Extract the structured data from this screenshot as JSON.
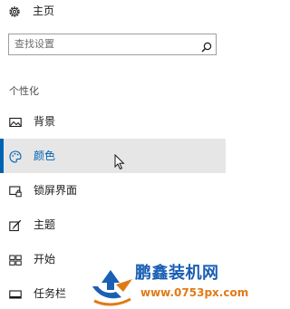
{
  "home": {
    "label": "主页",
    "icon": "gear-icon"
  },
  "search": {
    "placeholder": "查找设置",
    "icon": "search-icon"
  },
  "section_title": "个性化",
  "nav": [
    {
      "label": "背景",
      "icon": "image-icon",
      "selected": false
    },
    {
      "label": "颜色",
      "icon": "palette-icon",
      "selected": true
    },
    {
      "label": "锁屏界面",
      "icon": "lock-screen-icon",
      "selected": false
    },
    {
      "label": "主题",
      "icon": "theme-brush-icon",
      "selected": false
    },
    {
      "label": "开始",
      "icon": "start-grid-icon",
      "selected": false
    },
    {
      "label": "任务栏",
      "icon": "taskbar-icon",
      "selected": false
    }
  ],
  "colors": {
    "accent": "#0063b1",
    "selected_bg": "#e6e6e6",
    "watermark_blue": "#1a5fb4",
    "watermark_orange": "#e07a17"
  },
  "watermark": {
    "brand": "鹏鑫装机网",
    "url": "www.0753px.com"
  }
}
